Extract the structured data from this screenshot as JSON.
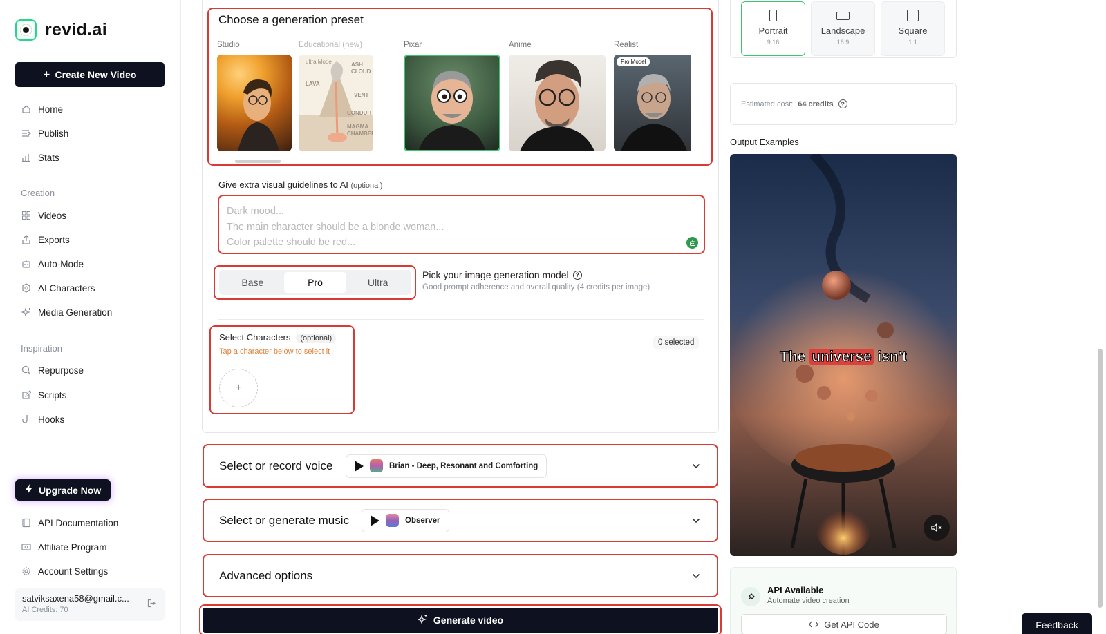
{
  "brand": {
    "name": "revid.ai"
  },
  "sidebar": {
    "create_label": "Create New Video",
    "main_items": [
      {
        "label": "Home"
      },
      {
        "label": "Publish"
      },
      {
        "label": "Stats"
      }
    ],
    "creation_heading": "Creation",
    "creation_items": [
      {
        "label": "Videos"
      },
      {
        "label": "Exports"
      },
      {
        "label": "Auto-Mode"
      },
      {
        "label": "AI Characters"
      },
      {
        "label": "Media Generation"
      }
    ],
    "inspiration_heading": "Inspiration",
    "inspiration_items": [
      {
        "label": "Repurpose"
      },
      {
        "label": "Scripts"
      },
      {
        "label": "Hooks"
      }
    ],
    "upgrade_label": "Upgrade Now",
    "bottom_items": [
      {
        "label": "API Documentation"
      },
      {
        "label": "Affiliate Program"
      },
      {
        "label": "Account Settings"
      }
    ],
    "account": {
      "email": "satviksaxena58@gmail.c...",
      "credits": "AI Credits: 70"
    }
  },
  "preset": {
    "title": "Choose a generation preset",
    "items": [
      {
        "label": "Studio"
      },
      {
        "label": "Educational (new)",
        "badge": "ultra Model",
        "tags": [
          "ASH CLOUD",
          "LAVA",
          "VENT",
          "CONDUIT",
          "MAGMA CHAMBER"
        ]
      },
      {
        "label": "Pixar"
      },
      {
        "label": "Anime"
      },
      {
        "label": "Realist",
        "badge": "Pro Model"
      }
    ],
    "selected": "Pixar"
  },
  "guidelines": {
    "label": "Give extra visual guidelines to AI",
    "optional": "(optional)",
    "placeholder": "Dark mood...\nThe main character should be a blonde woman...\nColor palette should be red..."
  },
  "model": {
    "options": [
      "Base",
      "Pro",
      "Ultra"
    ],
    "selected": "Pro",
    "title": "Pick your image generation model",
    "subtitle": "Good prompt adherence and overall quality (4 credits per image)"
  },
  "characters": {
    "title": "Select Characters",
    "optional": "(optional)",
    "hint": "Tap a character below to select it",
    "selected_count": "0 selected"
  },
  "voice": {
    "title": "Select or record voice",
    "value": "Brian - Deep, Resonant and Comforting"
  },
  "music": {
    "title": "Select or generate music",
    "value": "Observer"
  },
  "advanced": {
    "title": "Advanced options"
  },
  "generate_label": "Generate video",
  "format": {
    "options": [
      {
        "name": "Portrait",
        "ratio": "9:16"
      },
      {
        "name": "Landscape",
        "ratio": "16:9"
      },
      {
        "name": "Square",
        "ratio": "1:1"
      }
    ],
    "selected": "Portrait"
  },
  "cost": {
    "label": "Estimated cost:",
    "value": "64 credits"
  },
  "output": {
    "label": "Output Examples",
    "caption_before": "The",
    "caption_highlight": "universe",
    "caption_after": "isn't"
  },
  "api": {
    "title": "API Available",
    "subtitle": "Automate video creation",
    "button": "Get API Code"
  },
  "feedback_label": "Feedback",
  "colors": {
    "accent_red": "#d93a34",
    "dark": "#0e1220",
    "green": "#3cc56e",
    "hint_orange": "#e0843c"
  }
}
